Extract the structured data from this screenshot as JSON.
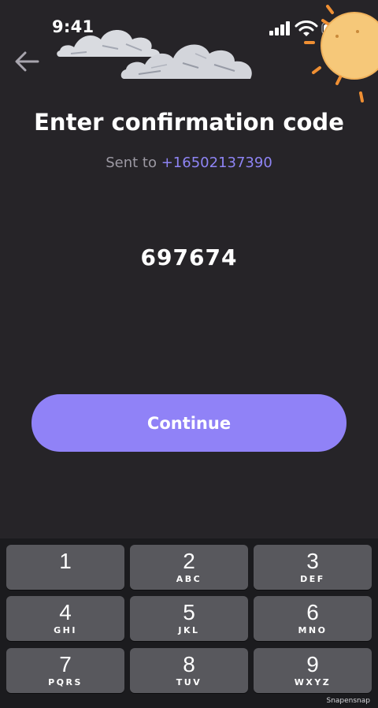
{
  "status_bar": {
    "time": "9:41",
    "icons": [
      "signal-icon",
      "wifi-icon",
      "battery-icon"
    ]
  },
  "header": {
    "back_icon": "arrow-left-icon"
  },
  "main": {
    "title": "Enter confirmation code",
    "sent_label": "Sent to",
    "phone_number": "+16502137390",
    "code": "697674",
    "continue_label": "Continue"
  },
  "keypad": {
    "keys": [
      {
        "digit": "1",
        "letters": ""
      },
      {
        "digit": "2",
        "letters": "ABC"
      },
      {
        "digit": "3",
        "letters": "DEF"
      },
      {
        "digit": "4",
        "letters": "GHI"
      },
      {
        "digit": "5",
        "letters": "JKL"
      },
      {
        "digit": "6",
        "letters": "MNO"
      },
      {
        "digit": "7",
        "letters": "PQRS"
      },
      {
        "digit": "8",
        "letters": "TUV"
      },
      {
        "digit": "9",
        "letters": "WXYZ"
      }
    ]
  },
  "watermark": "Snapensnap",
  "colors": {
    "background": "#262428",
    "accent": "#9082f7",
    "phone_link": "#8e84f4",
    "muted_text": "#9c99a3",
    "key_background": "#58585d",
    "keypad_background": "#1b1b1e"
  }
}
